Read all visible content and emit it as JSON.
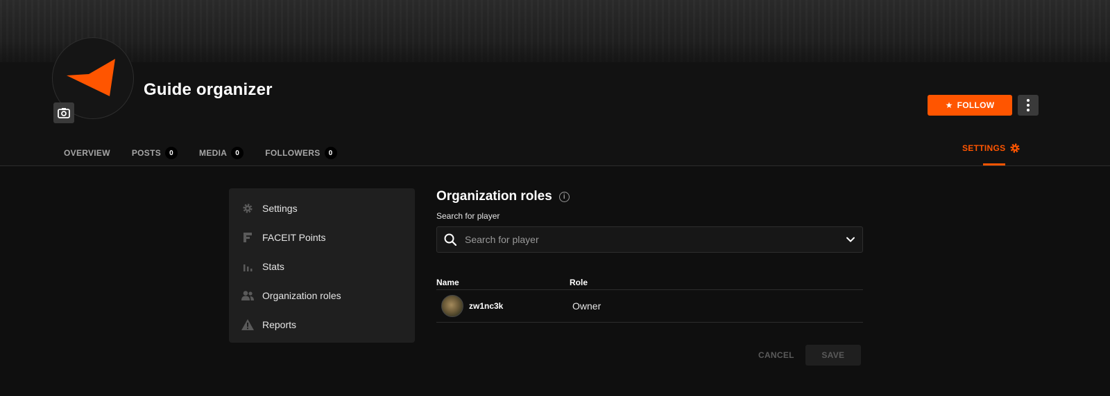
{
  "profile": {
    "name": "Guide organizer",
    "follow_label": "FOLLOW"
  },
  "tabs": [
    {
      "label": "OVERVIEW"
    },
    {
      "label": "POSTS",
      "count": "0"
    },
    {
      "label": "MEDIA",
      "count": "0"
    },
    {
      "label": "FOLLOWERS",
      "count": "0"
    }
  ],
  "settings_tab": {
    "label": "SETTINGS"
  },
  "side_menu": {
    "items": [
      {
        "label": "Settings",
        "icon": "gear-icon"
      },
      {
        "label": "FACEIT Points",
        "icon": "faceit-f-icon"
      },
      {
        "label": "Stats",
        "icon": "bar-chart-icon"
      },
      {
        "label": "Organization roles",
        "icon": "users-icon"
      },
      {
        "label": "Reports",
        "icon": "warning-icon"
      }
    ]
  },
  "main": {
    "title": "Organization roles",
    "search_label": "Search for player",
    "search_placeholder": "Search for player",
    "table": {
      "headers": {
        "name": "Name",
        "role": "Role"
      },
      "rows": [
        {
          "name": "zw1nc3k",
          "role": "Owner"
        }
      ]
    },
    "cancel_label": "CANCEL",
    "save_label": "SAVE"
  },
  "colors": {
    "accent": "#ff5500",
    "background": "#121212",
    "panel": "#1f1f1f"
  }
}
